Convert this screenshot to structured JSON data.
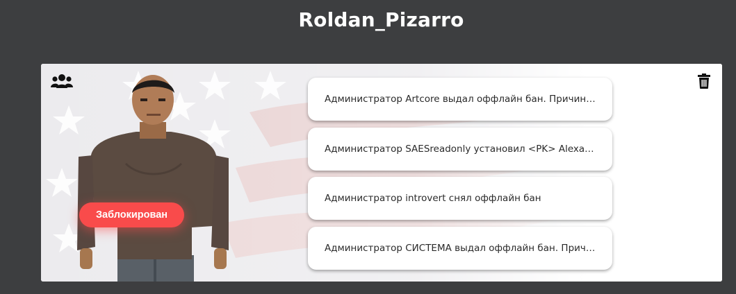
{
  "header": {
    "title": "Roldan_Pizarro"
  },
  "profile": {
    "status_badge": "Заблокирован",
    "icons": {
      "members": "users-icon",
      "delete": "trash-icon"
    },
    "status_color": "#f94b4b"
  },
  "logs": [
    {
      "text": "Администратор Artcore выдал оффлайн бан. Причина: ..."
    },
    {
      "text": "Администратор SAESreadonly установил <PK> Alexander ..."
    },
    {
      "text": "Администратор introvert снял оффлайн бан"
    },
    {
      "text": "Администратор СИСТЕМА выдал оффлайн бан. Причина: ..."
    }
  ]
}
